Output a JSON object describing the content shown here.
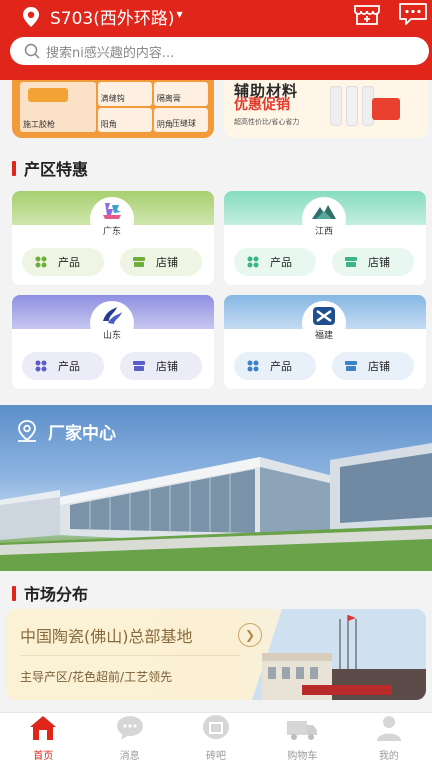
{
  "header": {
    "location": "S703(西外环路)",
    "search_placeholder": "搜索ni感兴趣的内容..."
  },
  "banners": {
    "left": {
      "labels": [
        "施工胶枪",
        "滴缝钩",
        "隔离膏",
        "阳角",
        "阴角",
        "压缝球"
      ]
    },
    "right": {
      "title": "辅助材料",
      "promo": "优惠促销",
      "sub": "超高性价比/省心省力"
    }
  },
  "regions": {
    "title": "产区特惠",
    "product_label": "产品",
    "shop_label": "店铺",
    "items": [
      {
        "name": "广东",
        "color": "#a7cf6f"
      },
      {
        "name": "江西",
        "color": "#86dcbf"
      },
      {
        "name": "山东",
        "color": "#8e8fe0"
      },
      {
        "name": "福建",
        "color": "#86b6e4"
      }
    ]
  },
  "factory": {
    "title": "厂家中心"
  },
  "market": {
    "title": "市场分布",
    "card_title": "中国陶瓷(佛山)总部基地",
    "card_sub": "主导产区/花色超前/工艺领先"
  },
  "tabbar": {
    "items": [
      {
        "label": "首页",
        "icon": "home-icon",
        "active": true
      },
      {
        "label": "消息",
        "icon": "message-icon",
        "active": false
      },
      {
        "label": "砖吧",
        "icon": "tile-bar-icon",
        "active": false
      },
      {
        "label": "购物车",
        "icon": "cart-icon",
        "active": false
      },
      {
        "label": "我的",
        "icon": "profile-icon",
        "active": false
      }
    ]
  },
  "colors": {
    "brand": "#e0251b",
    "accent_text": "#8a6a3a"
  }
}
